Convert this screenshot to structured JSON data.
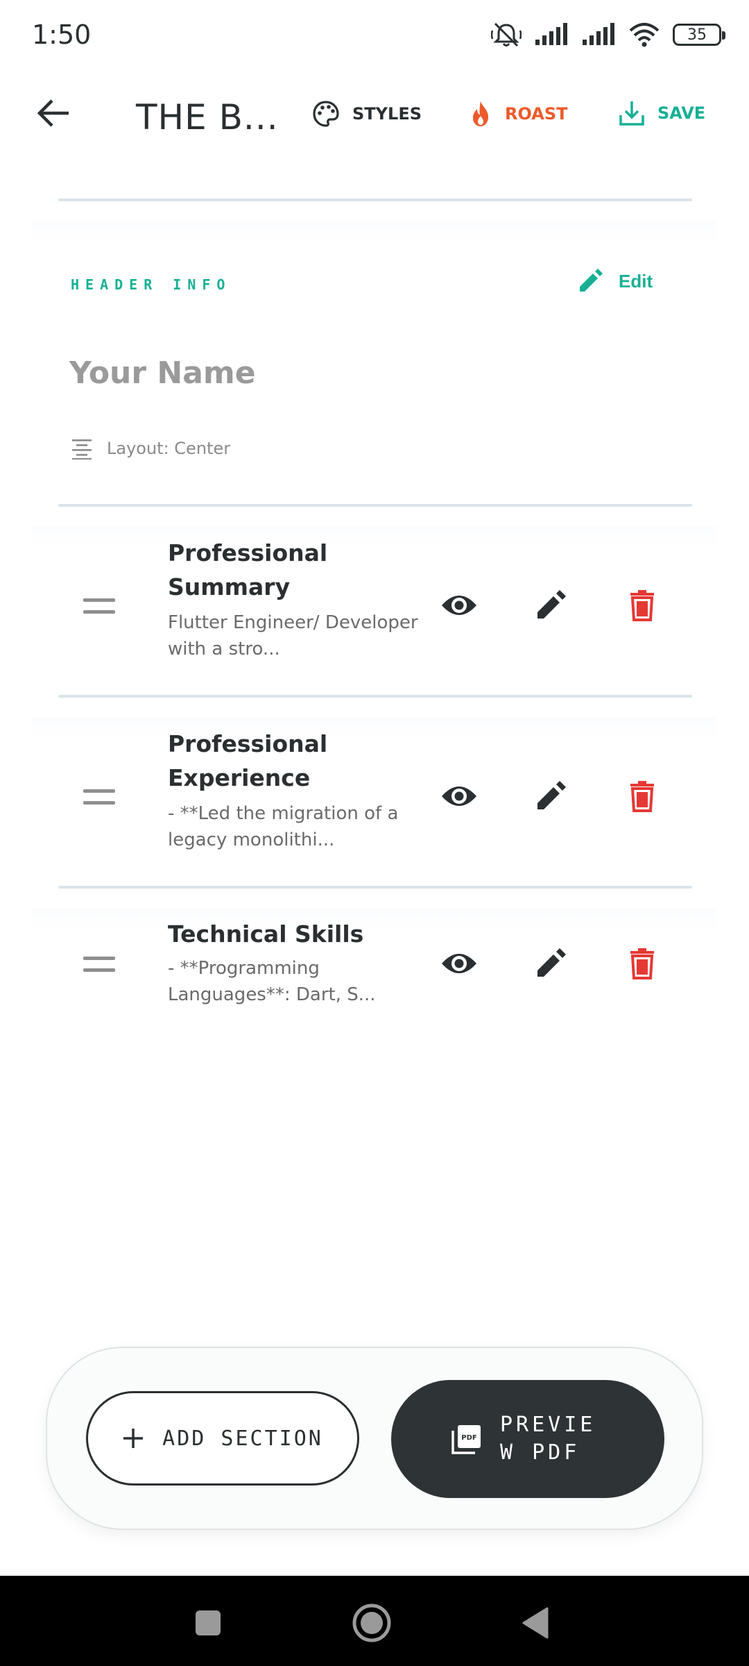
{
  "status_bar": {
    "time": "1:50",
    "battery": "35"
  },
  "app_bar": {
    "title": "THE B...",
    "styles_label": "STYLES",
    "roast_label": "ROAST",
    "save_label": "SAVE"
  },
  "header_card": {
    "section_label": "HEADER INFO",
    "edit_label": "Edit",
    "name_placeholder": "Your Name",
    "layout_text": "Layout: Center"
  },
  "sections": [
    {
      "title": "Professional Summary",
      "description": "Flutter Engineer/ Developer with a stro..."
    },
    {
      "title": "Professional Experience",
      "description": "- **Led the migration of a legacy monolithi..."
    },
    {
      "title": "Technical Skills",
      "description": "- **Programming Languages**: Dart, S..."
    }
  ],
  "bottom_actions": {
    "add_section_label": "ADD SECTION",
    "preview_label": "PREVIEW PDF"
  },
  "colors": {
    "accent_green": "#17b095",
    "roast_orange": "#ec5a2c",
    "delete_red": "#e53935",
    "dark": "#2e3335"
  },
  "icons": {
    "styles": "palette-icon",
    "roast": "flame-icon",
    "save": "download-icon",
    "edit": "pencil-icon",
    "layout": "align-center-icon",
    "visibility": "eye-icon",
    "delete": "trash-icon",
    "add": "plus-icon",
    "preview": "pdf-icon"
  }
}
